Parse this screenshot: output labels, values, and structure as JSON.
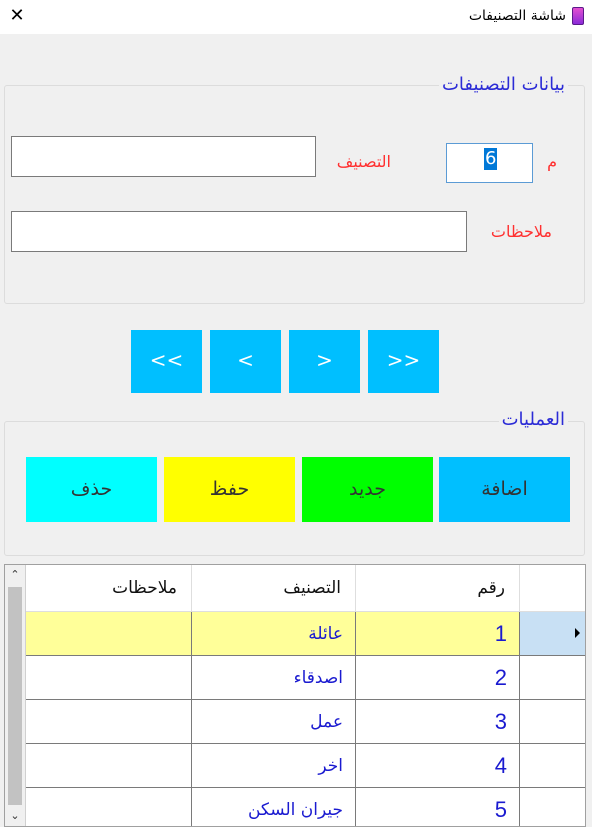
{
  "window": {
    "title": "شاشة التصنيفات",
    "close_glyph": "✕",
    "app_icon": "app-icon"
  },
  "data_group": {
    "title": "بيانات التصنيفات",
    "id_label": "م",
    "id_value": "6",
    "category_label": "التصنيف",
    "category_value": "",
    "notes_label": "ملاحظات",
    "notes_value": ""
  },
  "navigation": {
    "first": "<<",
    "previous": "<",
    "next": ">",
    "last": ">>"
  },
  "operations": {
    "title": "العمليات",
    "add_label": "اضافة",
    "new_label": "جديد",
    "save_label": "حفظ",
    "delete_label": "حذف",
    "colors": {
      "add": "#00bfff",
      "new": "#00ff00",
      "save": "#ffff00",
      "delete": "#00ffff"
    }
  },
  "grid": {
    "columns": [
      "رقم",
      "التصنيف",
      "ملاحظات"
    ],
    "selected_row": 0,
    "selected_row_color": "#ffff99",
    "rows": [
      {
        "id": "1",
        "name": "عائلة",
        "notes": ""
      },
      {
        "id": "2",
        "name": "اصدقاء",
        "notes": ""
      },
      {
        "id": "3",
        "name": "عمل",
        "notes": ""
      },
      {
        "id": "4",
        "name": "اخر",
        "notes": ""
      },
      {
        "id": "5",
        "name": "جيران السكن",
        "notes": ""
      }
    ],
    "scroll_up_icon": "scroll-up-arrow-icon",
    "scroll_down_icon": "scroll-down-arrow-icon"
  }
}
